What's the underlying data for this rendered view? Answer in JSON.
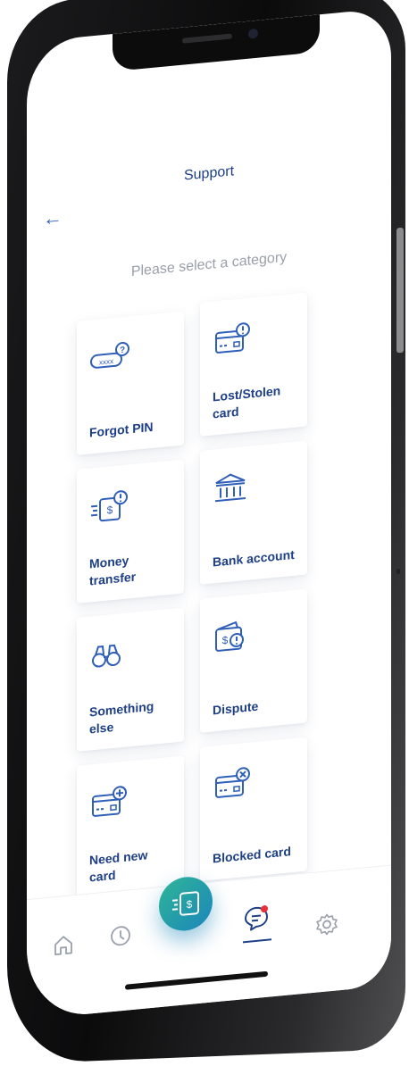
{
  "header": {
    "title": "Support",
    "back_icon": "arrow-left-icon"
  },
  "subtitle": "Please select a category",
  "categories": [
    {
      "label": "Forgot PIN",
      "icon": "pin-question-icon"
    },
    {
      "label": "Lost/Stolen card",
      "icon": "card-alert-icon"
    },
    {
      "label": "Money transfer",
      "icon": "money-transfer-alert-icon"
    },
    {
      "label": "Bank account",
      "icon": "bank-icon"
    },
    {
      "label": "Something else",
      "icon": "binoculars-icon"
    },
    {
      "label": "Dispute",
      "icon": "wallet-dispute-icon"
    },
    {
      "label": "Need new card",
      "icon": "card-add-icon"
    },
    {
      "label": "Blocked card",
      "icon": "card-blocked-icon"
    }
  ],
  "nav": {
    "items": [
      "home-icon",
      "history-icon",
      "transfer-icon",
      "support-chat-icon",
      "settings-icon"
    ],
    "active": "support-chat-icon",
    "notification_color": "#e8303a"
  },
  "colors": {
    "primary": "#1d3f87",
    "accent": "#2f5fb8",
    "fab_start": "#2fb597",
    "fab_end": "#1b86bb"
  }
}
